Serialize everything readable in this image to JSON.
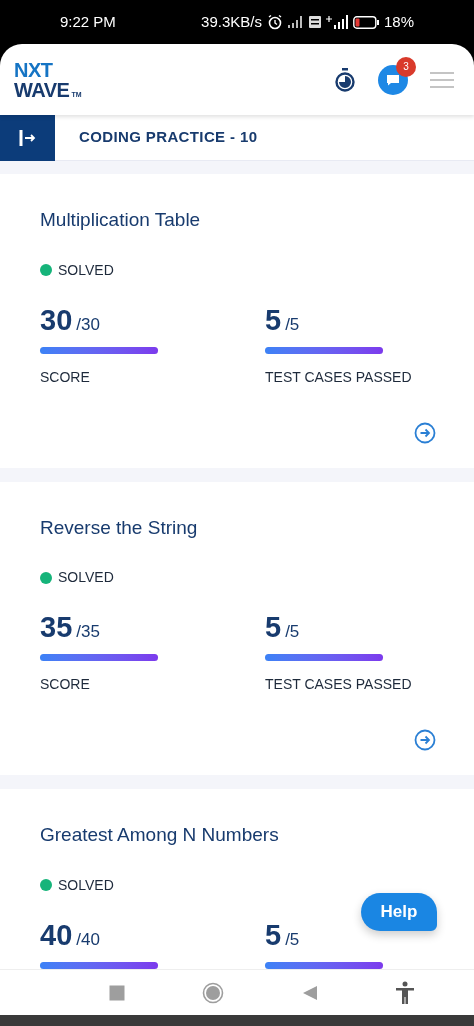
{
  "status_bar": {
    "time": "9:22 PM",
    "speed": "39.3KB/s",
    "battery": "18%"
  },
  "header": {
    "logo_top": "NXT",
    "logo_bottom": "WAVE",
    "logo_mark": "TM",
    "notifications": "3"
  },
  "sub_header": {
    "title": "CODING PRACTICE - 10"
  },
  "cards": [
    {
      "title": "Multiplication Table",
      "status": "SOLVED",
      "open": true,
      "metrics": [
        {
          "value": "30",
          "total": "/30",
          "level": 1,
          "label": "SCORE"
        },
        {
          "value": "5",
          "total": "/5",
          "level": 1,
          "label": "TEST CASES PASSED"
        }
      ]
    },
    {
      "title": "Reverse the String",
      "status": "SOLVED",
      "open": true,
      "metrics": [
        {
          "value": "35",
          "total": "/35",
          "level": 1,
          "label": "SCORE"
        },
        {
          "value": "5",
          "total": "/5",
          "level": 1,
          "label": "TEST CASES PASSED"
        }
      ]
    },
    {
      "title": "Greatest Among N Numbers",
      "status": "SOLVED",
      "open": false,
      "metrics": [
        {
          "value": "40",
          "total": "/40",
          "level": 1
        },
        {
          "value": "5",
          "total": "/5",
          "level": 1
        }
      ]
    }
  ],
  "help_button": {
    "label": "Help"
  }
}
